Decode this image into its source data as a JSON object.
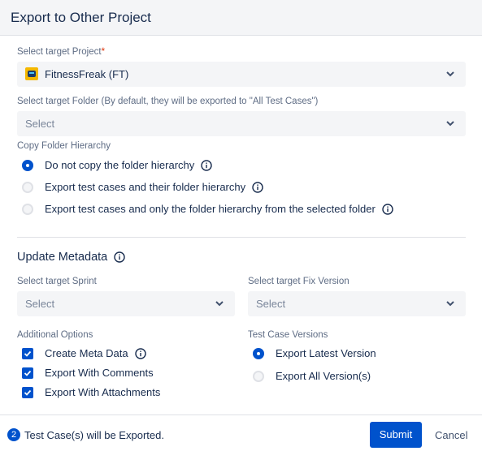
{
  "dialog": {
    "title": "Export to Other Project"
  },
  "project": {
    "label": "Select target Project",
    "required_mark": "*",
    "value": "FitnessFreak (FT)",
    "icon": "project-avatar-icon"
  },
  "folder": {
    "label": "Select target Folder (By default, they will be exported to \"All Test Cases\")",
    "placeholder": "Select"
  },
  "hierarchy": {
    "label": "Copy Folder Hierarchy",
    "options": [
      {
        "label": "Do not copy the folder hierarchy",
        "selected": true
      },
      {
        "label": "Export test cases and their folder hierarchy",
        "selected": false
      },
      {
        "label": "Export test cases and only the folder hierarchy from the selected folder",
        "selected": false
      }
    ]
  },
  "metadata": {
    "title": "Update Metadata",
    "sprint": {
      "label": "Select target Sprint",
      "placeholder": "Select"
    },
    "fix_version": {
      "label": "Select target Fix Version",
      "placeholder": "Select"
    }
  },
  "additional_options": {
    "label": "Additional Options",
    "items": [
      {
        "label": "Create Meta Data",
        "checked": true
      },
      {
        "label": "Export With Comments",
        "checked": true
      },
      {
        "label": "Export With Attachments",
        "checked": true
      }
    ]
  },
  "test_case_versions": {
    "label": "Test Case Versions",
    "options": [
      {
        "label": "Export Latest Version",
        "selected": true
      },
      {
        "label": "Export All Version(s)",
        "selected": false
      }
    ]
  },
  "footer": {
    "count": "2",
    "count_text": "Test Case(s) will be Exported.",
    "submit_label": "Submit",
    "cancel_label": "Cancel"
  },
  "colors": {
    "primary": "#0052cc",
    "field_bg": "#f4f5f7",
    "text": "#172b4d",
    "muted": "#5e6c84"
  }
}
